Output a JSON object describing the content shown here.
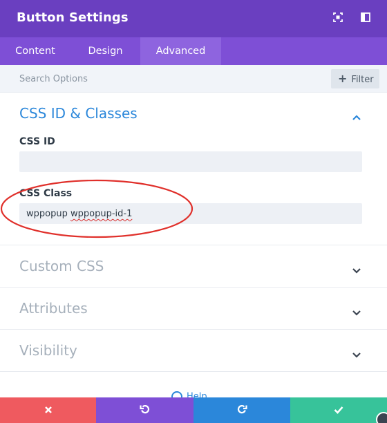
{
  "header": {
    "title": "Button Settings",
    "icons": [
      "fullscreen-icon",
      "sidebar-toggle-icon"
    ],
    "bg_color": "#6a3fc0"
  },
  "tabs": [
    {
      "label": "Content",
      "active": false
    },
    {
      "label": "Design",
      "active": false
    },
    {
      "label": "Advanced",
      "active": true
    }
  ],
  "search": {
    "placeholder": "Search Options",
    "filter_label": "Filter"
  },
  "sections": {
    "css_id_classes": {
      "title": "CSS ID & Classes",
      "expanded": true,
      "fields": {
        "css_id": {
          "label": "CSS ID",
          "value": ""
        },
        "css_class": {
          "label": "CSS Class",
          "value_part1": "wppopup",
          "value_part2": "wppopup-id-1"
        }
      }
    },
    "custom_css": {
      "title": "Custom CSS",
      "expanded": false
    },
    "attributes": {
      "title": "Attributes",
      "expanded": false
    },
    "visibility": {
      "title": "Visibility",
      "expanded": false
    }
  },
  "help": {
    "label": "Help"
  },
  "footer": {
    "buttons": [
      {
        "name": "discard",
        "icon": "close-icon",
        "color": "#ef5a5f"
      },
      {
        "name": "undo",
        "icon": "undo-icon",
        "color": "#7e4fd6"
      },
      {
        "name": "redo",
        "icon": "redo-icon",
        "color": "#2b87da"
      },
      {
        "name": "save",
        "icon": "check-icon",
        "color": "#37c39a"
      }
    ]
  },
  "colors": {
    "accent": "#2b87da",
    "annotation": "#e0302b"
  }
}
